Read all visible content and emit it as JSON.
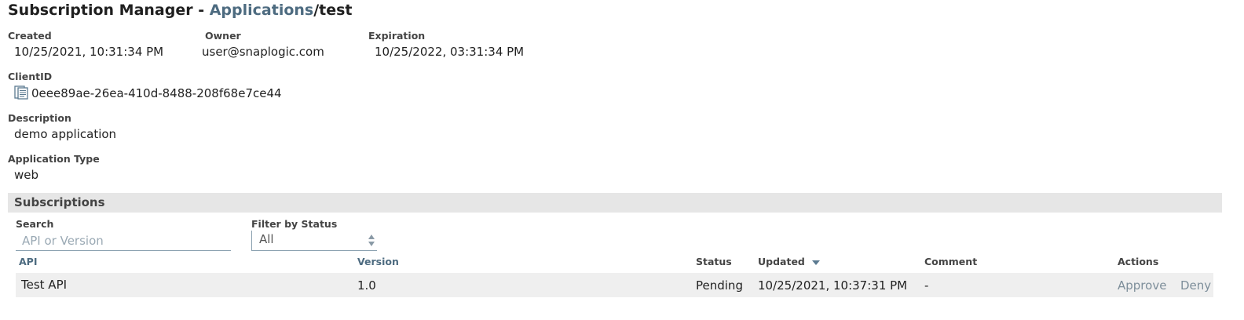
{
  "header": {
    "prefix": "Subscription Manager - ",
    "link": "Applications",
    "suffix": "/test"
  },
  "details": {
    "created_label": "Created",
    "created_value": "10/25/2021, 10:31:34 PM",
    "owner_label": "Owner",
    "owner_value": "user@snaplogic.com",
    "expiration_label": "Expiration",
    "expiration_value": "10/25/2022, 03:31:34 PM",
    "clientid_label": "ClientID",
    "clientid_value": "0eee89ae-26ea-410d-8488-208f68e7ce44",
    "clientid_icon": "copy-icon",
    "description_label": "Description",
    "description_value": "demo application",
    "apptype_label": "Application Type",
    "apptype_value": "web"
  },
  "subscriptions": {
    "title": "Subscriptions",
    "search_label": "Search",
    "search_placeholder": "API or Version",
    "filter_label": "Filter by Status",
    "filter_value": "All",
    "columns": {
      "api": "API",
      "version": "Version",
      "status": "Status",
      "updated": "Updated",
      "comment": "Comment",
      "actions": "Actions"
    },
    "rows": [
      {
        "api": "Test API",
        "version": "1.0",
        "status": "Pending",
        "updated": "10/25/2021, 10:37:31 PM",
        "comment": "-",
        "approve": "Approve",
        "deny": "Deny"
      }
    ]
  },
  "colors": {
    "link": "#4d6b80",
    "section_bg": "#e6e6e6",
    "row_bg": "#efefef",
    "action": "#7d8e9a"
  }
}
